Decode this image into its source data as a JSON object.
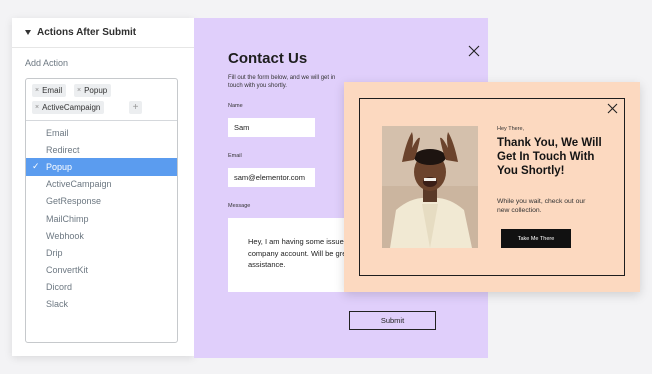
{
  "settings": {
    "section_title": "Actions After Submit",
    "field_label": "Add Action",
    "tags": [
      "Email",
      "Popup",
      "ActiveCampaign"
    ],
    "add_tag_icon": "+",
    "remove_tag_icon": "×",
    "options": [
      {
        "label": "Email",
        "selected": false
      },
      {
        "label": "Redirect",
        "selected": false
      },
      {
        "label": "Popup",
        "selected": true
      },
      {
        "label": "ActiveCampaign",
        "selected": false
      },
      {
        "label": "GetResponse",
        "selected": false
      },
      {
        "label": "MailChimp",
        "selected": false
      },
      {
        "label": "Webhook",
        "selected": false
      },
      {
        "label": "Drip",
        "selected": false
      },
      {
        "label": "ConvertKit",
        "selected": false
      },
      {
        "label": "Dicord",
        "selected": false
      },
      {
        "label": "Slack",
        "selected": false
      }
    ],
    "accent_color": "#5b9cef"
  },
  "form": {
    "title": "Contact Us",
    "description": "Fill out the form below, and we will get in touch with you shortly.",
    "name_label": "Name",
    "name_value": "Sam",
    "email_label": "Email",
    "email_value": "sam@elementor.com",
    "message_label": "Message",
    "message_value": "Hey, I am having some issues with the company account. Will be great for assistance.",
    "submit_label": "Submit",
    "background_color": "#e0cffb"
  },
  "popup": {
    "greeting": "Hey There,",
    "heading": "Thank You, We Will Get In Touch With You Shortly!",
    "body": "While you wait, check out our new collection.",
    "button_label": "Take Me There",
    "background_color": "#fcd9c0"
  }
}
